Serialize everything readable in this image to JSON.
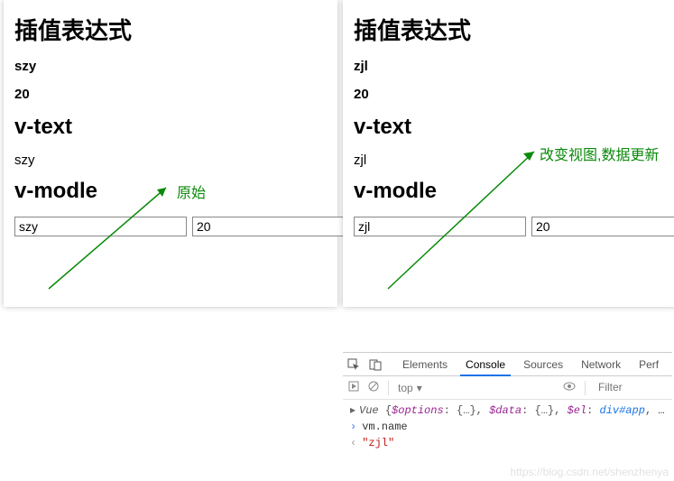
{
  "left": {
    "h1": "插值表达式",
    "name": "szy",
    "age": "20",
    "h2": "v-text",
    "vtext": "szy",
    "h3": "v-modle",
    "in_name": "szy",
    "in_age": "20",
    "annot": "原始"
  },
  "right": {
    "h1": "插值表达式",
    "name": "zjl",
    "age": "20",
    "h2": "v-text",
    "vtext": "zjl",
    "h3": "v-modle",
    "in_name": "zjl",
    "in_age": "20",
    "annot": "改变视图,数据更新"
  },
  "devtools": {
    "tabs": {
      "elements": "Elements",
      "console": "Console",
      "sources": "Sources",
      "network": "Network",
      "perf": "Perf"
    },
    "context": "top",
    "filter_ph": "Filter",
    "vue_line": {
      "pre": "Vue ",
      "opts": "$options",
      "data": "$data",
      "el": "$el",
      "elval": "div#app"
    },
    "cmd": "vm.name",
    "result": "\"zjl\""
  },
  "watermark": "https://blog.csdn.net/shenzhenya"
}
